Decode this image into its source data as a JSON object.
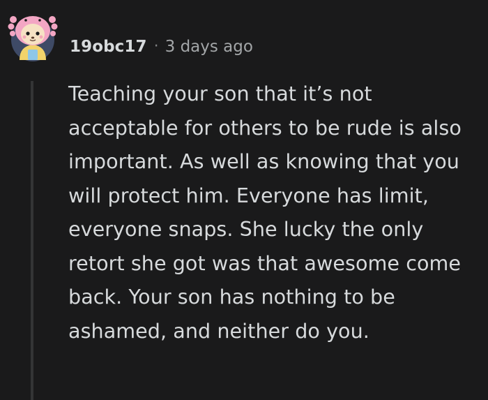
{
  "comment": {
    "author": "19obc17",
    "separator": "·",
    "timestamp": "3 days ago",
    "avatar_icon": "snoo-avatar-icon",
    "body": "Teaching your son that it’s not acceptable for others to be rude is also important. As well as knowing that you will protect him. Everyone has limit, everyone snaps. She lucky the only retort she got was that awesome come back. Your son has nothing to be ashamed, and neither do you."
  },
  "colors": {
    "background": "#1a1a1b",
    "text": "#d7dadc",
    "muted": "#818384",
    "thread_line": "#343536",
    "avatar_pink": "#f3a6c4",
    "avatar_bg": "#3e4a66"
  }
}
